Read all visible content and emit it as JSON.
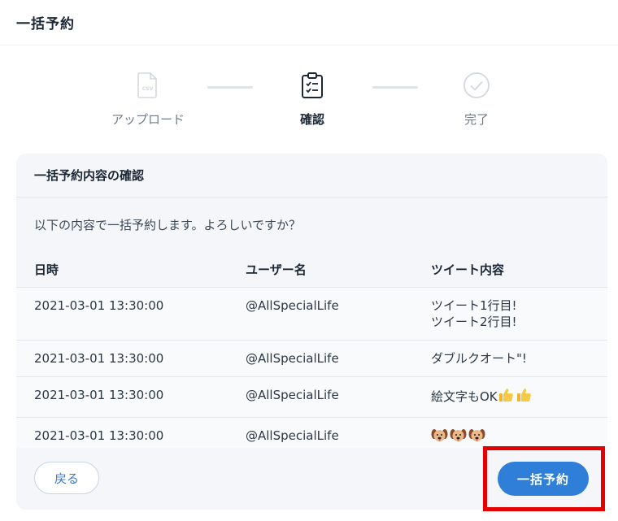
{
  "page": {
    "title": "一括予約"
  },
  "stepper": {
    "steps": [
      {
        "label": "アップロード",
        "state": "done",
        "icon": "csv-file-icon"
      },
      {
        "label": "確認",
        "state": "current",
        "icon": "clipboard-checklist-icon"
      },
      {
        "label": "完了",
        "state": "pending",
        "icon": "check-circle-icon"
      }
    ]
  },
  "confirm_card": {
    "title": "一括予約内容の確認",
    "message": "以下の内容で一括予約します。よろしいですか？",
    "table": {
      "headers": {
        "date": "日時",
        "user": "ユーザー名",
        "tweet": "ツイート内容"
      },
      "rows": [
        {
          "date": "2021-03-01 13:30:00",
          "user": "@AllSpecialLife",
          "tweet_lines": [
            "ツイート1行目!",
            "ツイート2行目!"
          ]
        },
        {
          "date": "2021-03-01 13:30:00",
          "user": "@AllSpecialLife",
          "tweet_lines": [
            "ダブルクオート\"!"
          ]
        },
        {
          "date": "2021-03-01 13:30:00",
          "user": "@AllSpecialLife",
          "tweet_lines": [
            "絵文字もOK"
          ],
          "emoji": [
            "thumbs-up-icon",
            "thumbs-up-icon"
          ]
        },
        {
          "date": "2021-03-01 13:30:00",
          "user": "@AllSpecialLife",
          "tweet_lines": [
            ""
          ],
          "emoji": [
            "dog-face-icon",
            "dog-face-icon",
            "dog-face-icon"
          ]
        }
      ]
    },
    "back_label": "戻る",
    "submit_label": "一括予約"
  },
  "colors": {
    "accent": "#2f7fd8",
    "highlight": "#e40000",
    "card_bg": "#f4f6f9"
  }
}
